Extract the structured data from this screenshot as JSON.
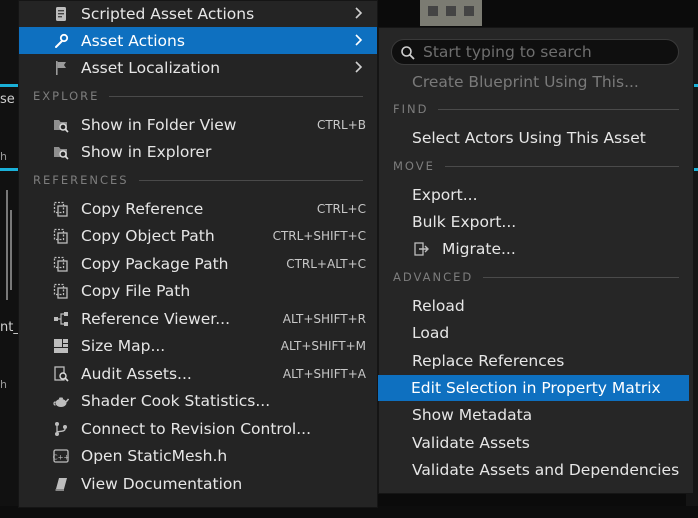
{
  "background": {
    "partial_texts": [
      "se",
      "h",
      "nt_",
      "h"
    ]
  },
  "main_menu": {
    "items_top": [
      {
        "label": "Scripted Asset Actions",
        "icon": "script-icon",
        "submenu": true
      },
      {
        "label": "Asset Actions",
        "icon": "wrench-icon",
        "submenu": true,
        "active": true
      },
      {
        "label": "Asset Localization",
        "icon": "flag-icon",
        "submenu": true
      }
    ],
    "explore_title": "EXPLORE",
    "explore_items": [
      {
        "label": "Show in Folder View",
        "shortcut": "CTRL+B",
        "icon": "folder-search-icon"
      },
      {
        "label": "Show in Explorer",
        "shortcut": "",
        "icon": "folder-search-icon"
      }
    ],
    "references_title": "REFERENCES",
    "references_items": [
      {
        "label": "Copy Reference",
        "shortcut": "CTRL+C",
        "icon": "copy-icon"
      },
      {
        "label": "Copy Object Path",
        "shortcut": "CTRL+SHIFT+C",
        "icon": "copy-icon"
      },
      {
        "label": "Copy Package Path",
        "shortcut": "CTRL+ALT+C",
        "icon": "copy-icon"
      },
      {
        "label": "Copy File Path",
        "shortcut": "",
        "icon": "copy-icon"
      },
      {
        "label": "Reference Viewer...",
        "shortcut": "ALT+SHIFT+R",
        "icon": "reference-viewer-icon"
      },
      {
        "label": "Size Map...",
        "shortcut": "ALT+SHIFT+M",
        "icon": "size-map-icon"
      },
      {
        "label": "Audit Assets...",
        "shortcut": "ALT+SHIFT+A",
        "icon": "audit-icon"
      },
      {
        "label": "Shader Cook Statistics...",
        "shortcut": "",
        "icon": "teapot-icon"
      },
      {
        "label": "Connect to Revision Control...",
        "shortcut": "",
        "icon": "branch-icon"
      },
      {
        "label": "Open StaticMesh.h",
        "shortcut": "",
        "icon": "code-file-icon"
      },
      {
        "label": "View Documentation",
        "shortcut": "",
        "icon": "book-icon"
      }
    ]
  },
  "sub_menu": {
    "search_placeholder": "Start typing to search",
    "create_blueprint": "Create Blueprint Using This...",
    "find_title": "FIND",
    "find_items": [
      "Select Actors Using This Asset"
    ],
    "move_title": "MOVE",
    "move_items": [
      "Export...",
      "Bulk Export...",
      "Migrate..."
    ],
    "advanced_title": "ADVANCED",
    "advanced_items": [
      "Reload",
      "Load",
      "Replace References",
      "Edit Selection in Property Matrix",
      "Show Metadata",
      "Validate Assets",
      "Validate Assets and Dependencies"
    ]
  },
  "colors": {
    "menu_bg": "#242424",
    "highlight": "#0e70c0",
    "section_text": "#7d7d7d",
    "accent_cyan": "#1ab0d8"
  }
}
